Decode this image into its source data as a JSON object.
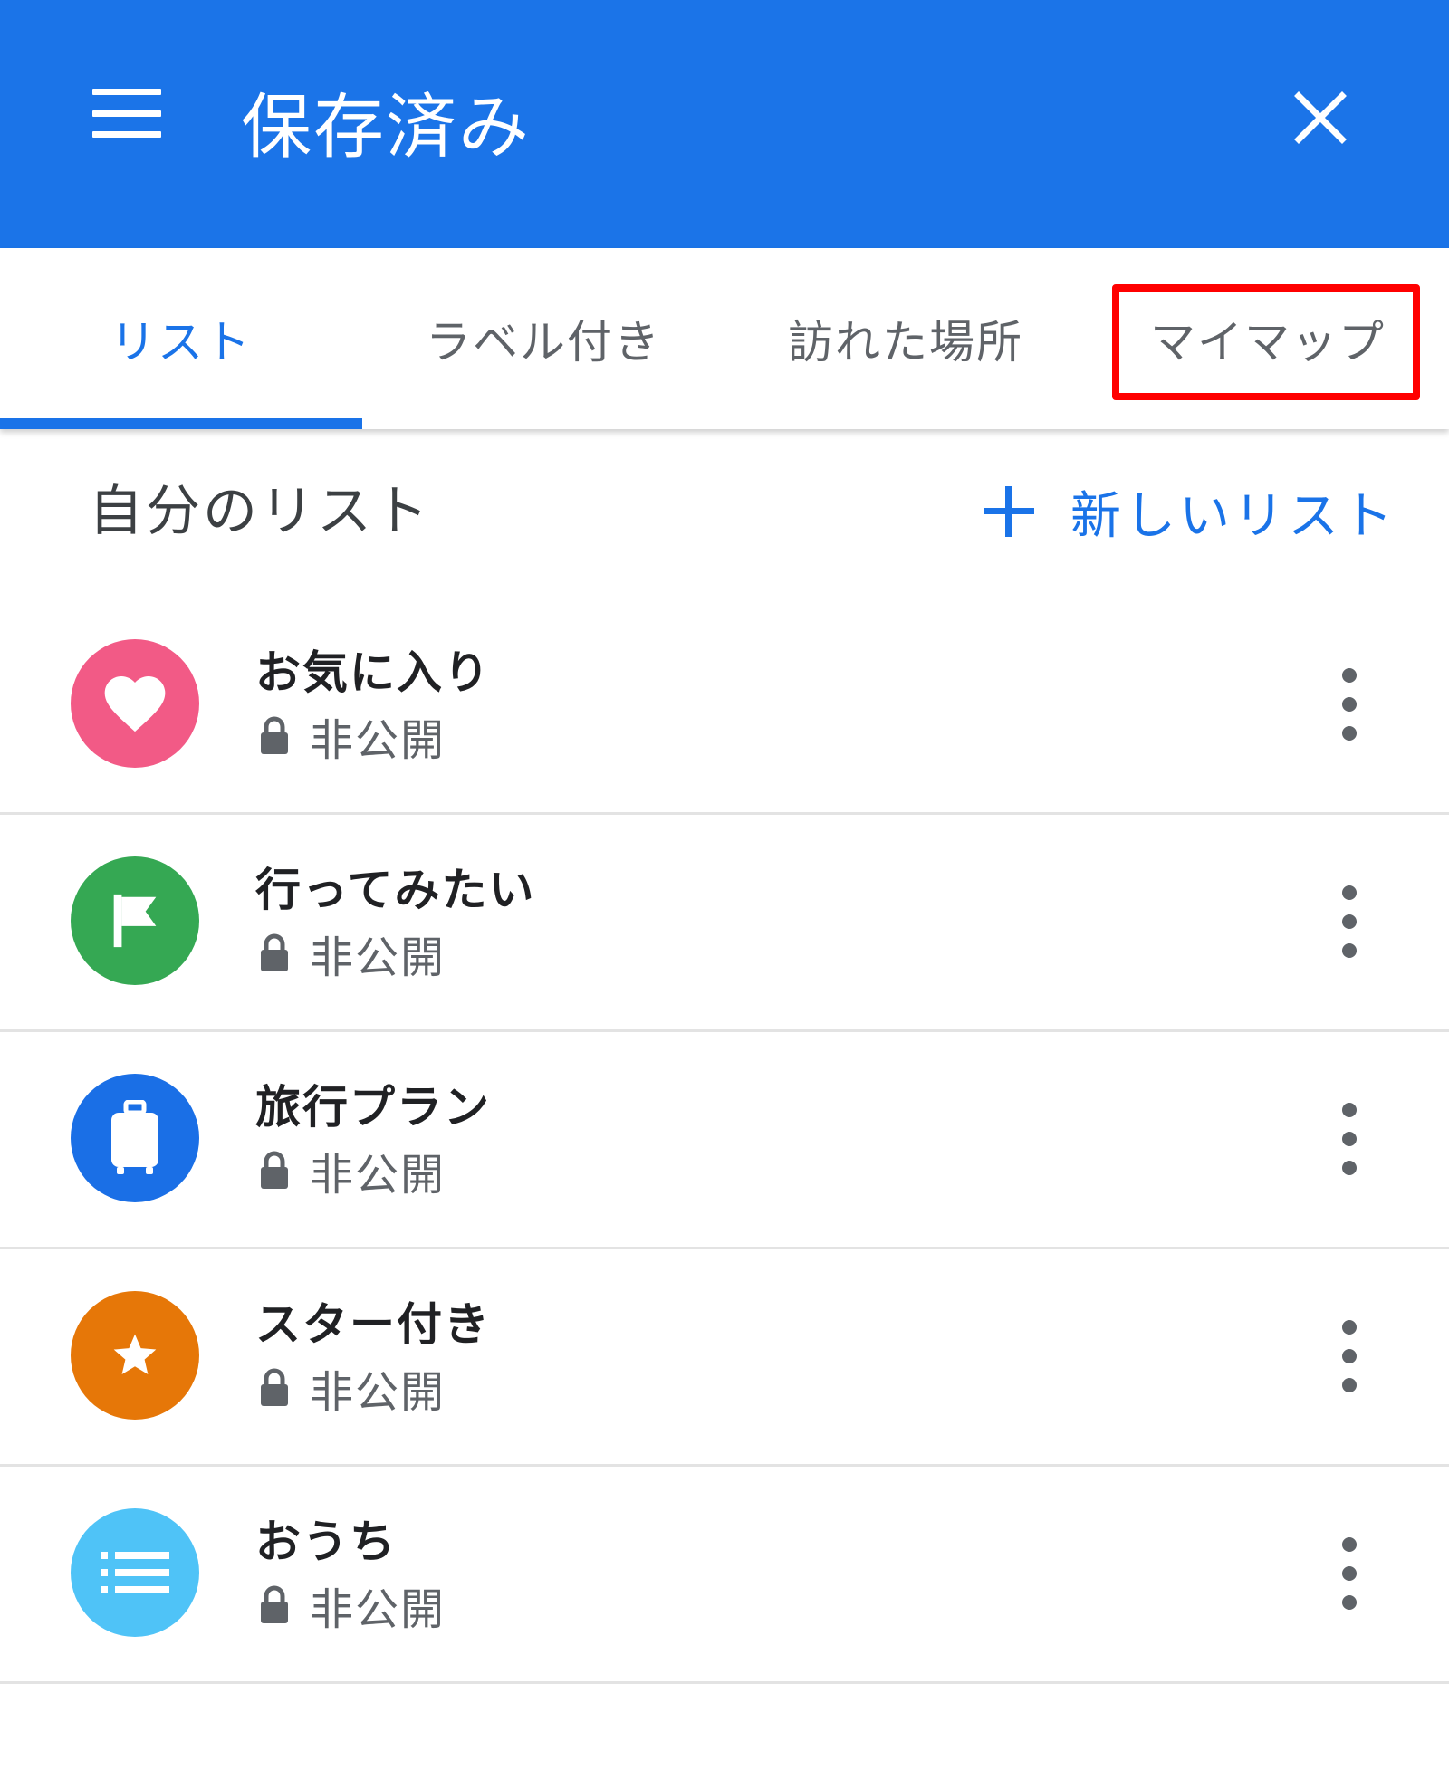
{
  "header": {
    "title": "保存済み",
    "background": "#1b74e8"
  },
  "tabs": [
    {
      "label": "リスト",
      "active": true
    },
    {
      "label": "ラベル付き",
      "active": false
    },
    {
      "label": "訪れた場所",
      "active": false
    },
    {
      "label": "マイマップ",
      "active": false,
      "highlighted": true
    }
  ],
  "section": {
    "title": "自分のリスト",
    "new_list_label": "新しいリスト"
  },
  "lists": [
    {
      "title": "お気に入り",
      "subtitle": "非公開",
      "icon": "heart-icon",
      "color": "#f25a86"
    },
    {
      "title": "行ってみたい",
      "subtitle": "非公開",
      "icon": "flag-icon",
      "color": "#35a853"
    },
    {
      "title": "旅行プラン",
      "subtitle": "非公開",
      "icon": "suitcase-icon",
      "color": "#1a6fe6"
    },
    {
      "title": "スター付き",
      "subtitle": "非公開",
      "icon": "star-icon",
      "color": "#e67708"
    },
    {
      "title": "おうち",
      "subtitle": "非公開",
      "icon": "list-icon",
      "color": "#4fc3f7"
    }
  ],
  "colors": {
    "accent": "#1a73e8",
    "highlight": "#ff0000"
  }
}
